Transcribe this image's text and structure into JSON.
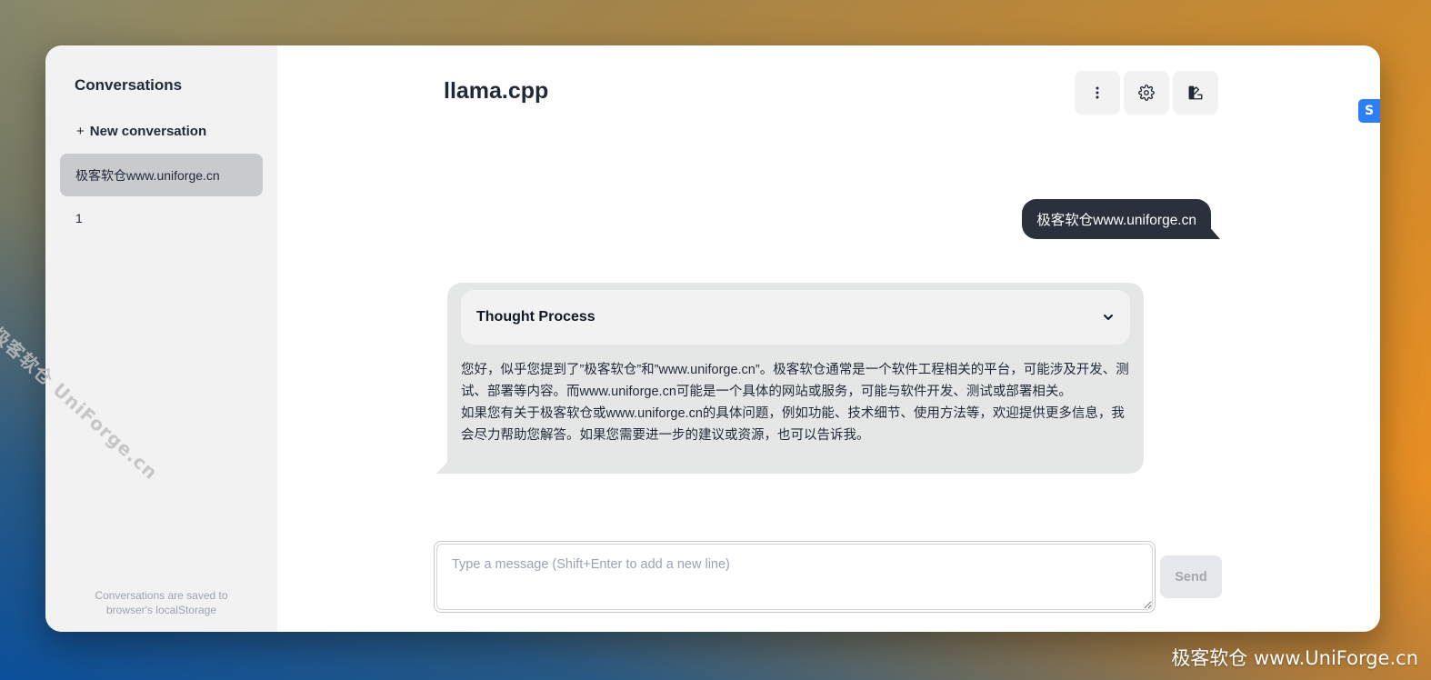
{
  "sidebar": {
    "title": "Conversations",
    "new_conversation_label": "New conversation",
    "new_conversation_icon": "+",
    "conversations": [
      {
        "label": "极客软仓www.uniforge.cn",
        "active": true
      },
      {
        "label": "1",
        "active": false
      }
    ],
    "footer": "Conversations are saved to browser's localStorage"
  },
  "header": {
    "title": "llama.cpp",
    "buttons": [
      "more-vertical-icon",
      "gear-icon",
      "theme-palette-icon"
    ]
  },
  "messages": {
    "user": "极客软仓www.uniforge.cn",
    "assistant": {
      "thought_label": "Thought Process",
      "paragraphs": [
        "您好，似乎您提到了”极客软仓”和”www.uniforge.cn”。极客软仓通常是一个软件工程相关的平台，可能涉及开发、测试、部署等内容。而www.uniforge.cn可能是一个具体的网站或服务，可能与软件开发、测试或部署相关。",
        "如果您有关于极客软仓或www.uniforge.cn的具体问题，例如功能、技术细节、使用方法等，欢迎提供更多信息，我会尽力帮助您解答。如果您需要进一步的建议或资源，也可以告诉我。"
      ]
    }
  },
  "composer": {
    "placeholder": "Type a message (Shift+Enter to add a new line)",
    "send_label": "Send"
  },
  "overlay": {
    "side_badge": "S",
    "watermark_diagonal": "极客软仓 UniForge.cn",
    "watermark_corner": "极客软仓 www.UniForge.cn"
  },
  "colors": {
    "user_bubble": "#2a313c",
    "assistant_bubble": "#e5e7e7",
    "sidebar_bg": "#f2f2f2",
    "active_item": "#c9cace"
  }
}
